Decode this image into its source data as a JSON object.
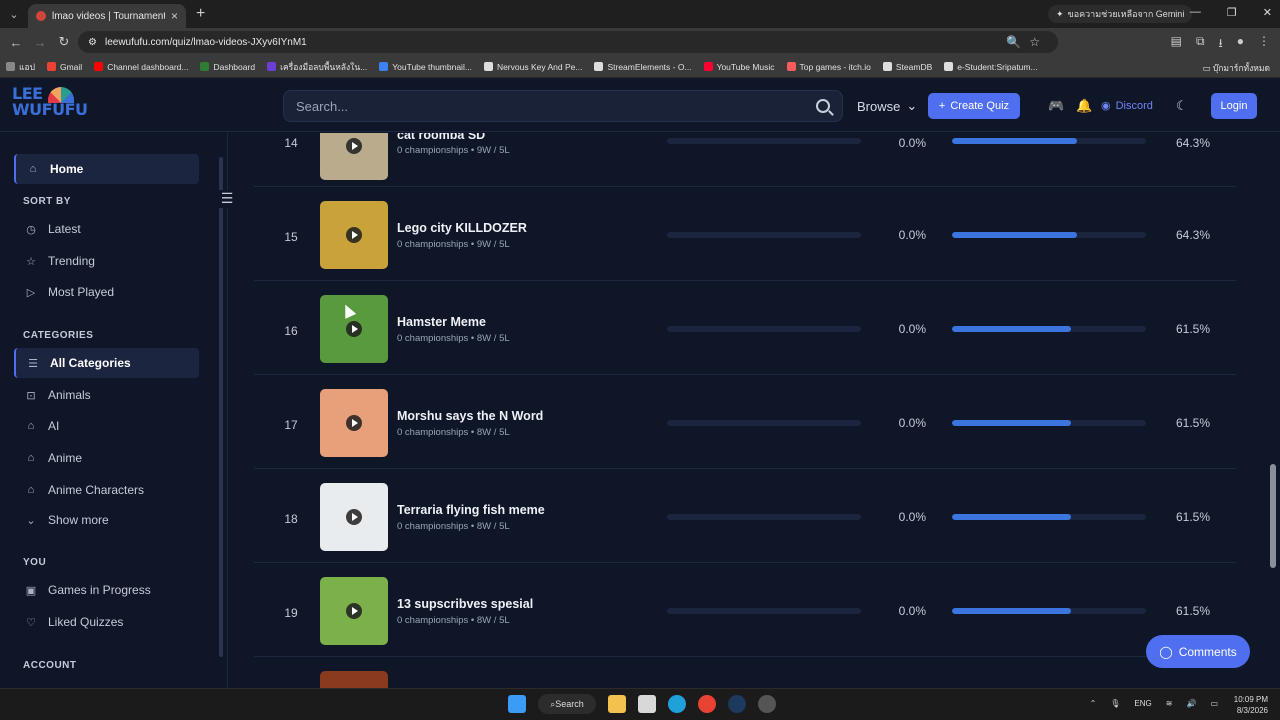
{
  "browser": {
    "tab_title": "lmao videos | Tournament, Tie",
    "url": "leewufufu.com/quiz/lmao-videos-JXyv6IYnM1",
    "gemini_label": "ขอความช่วยเหลือจาก Gemini",
    "bookmarks": [
      "แอป",
      "Gmail",
      "Channel dashboard...",
      "Dashboard",
      "เครื่องมือลบพื้นหลังใน...",
      "YouTube thumbnail...",
      "Nervous Key And Pe...",
      "StreamElements - O...",
      "YouTube Music",
      "Top games - itch.io",
      "SteamDB",
      "e-Student:Sripatum..."
    ],
    "bookmark_colors": [
      "#888888",
      "#ea4335",
      "#ff0000",
      "#2e7d32",
      "#6b3fd4",
      "#3b82f6",
      "#dddddd",
      "#dddddd",
      "#ff0033",
      "#fa5c5c",
      "#dddddd",
      "#dddddd"
    ],
    "bookmark_folder": "บุ๊กมาร์กทั้งหมด"
  },
  "header": {
    "logo_line1": "LEE",
    "logo_line2": "WUFUFU",
    "search_placeholder": "Search...",
    "browse_label": "Browse",
    "create_label": "Create Quiz",
    "discord_label": "Discord",
    "login_label": "Login"
  },
  "sidebar": {
    "home": "Home",
    "sort_heading": "SORT BY",
    "sort_items": [
      "Latest",
      "Trending",
      "Most Played"
    ],
    "categories_heading": "CATEGORIES",
    "category_items": [
      "All Categories",
      "Animals",
      "AI",
      "Anime",
      "Anime Characters"
    ],
    "show_more": "Show more",
    "you_heading": "YOU",
    "you_items": [
      "Games in Progress",
      "Liked Quizzes"
    ],
    "account_heading": "ACCOUNT"
  },
  "rows": [
    {
      "rank": "14",
      "title": "cat roomba SD",
      "meta": "0 championships • 9W / 5L",
      "pct1": "0.0%",
      "pct2": "64.3%",
      "win": 0.643,
      "thumb": "#b9ab8c"
    },
    {
      "rank": "15",
      "title": "Lego city KILLDOZER",
      "meta": "0 championships • 9W / 5L",
      "pct1": "0.0%",
      "pct2": "64.3%",
      "win": 0.643,
      "thumb": "#c9a23a"
    },
    {
      "rank": "16",
      "title": "Hamster Meme",
      "meta": "0 championships • 8W / 5L",
      "pct1": "0.0%",
      "pct2": "61.5%",
      "win": 0.615,
      "thumb": "#5a9a3e"
    },
    {
      "rank": "17",
      "title": "Morshu says the N Word",
      "meta": "0 championships • 8W / 5L",
      "pct1": "0.0%",
      "pct2": "61.5%",
      "win": 0.615,
      "thumb": "#e8a07a"
    },
    {
      "rank": "18",
      "title": "Terraria flying fish meme",
      "meta": "0 championships • 8W / 5L",
      "pct1": "0.0%",
      "pct2": "61.5%",
      "win": 0.615,
      "thumb": "#e9ecef"
    },
    {
      "rank": "19",
      "title": "13 supscribves spesial",
      "meta": "0 championships • 8W / 5L",
      "pct1": "0.0%",
      "pct2": "61.5%",
      "win": 0.615,
      "thumb": "#7bb04a"
    }
  ],
  "comments_label": "Comments",
  "taskbar": {
    "search_label": "Search",
    "lang": "ENG",
    "time": "10:09 PM",
    "date": "8/3/2026"
  }
}
